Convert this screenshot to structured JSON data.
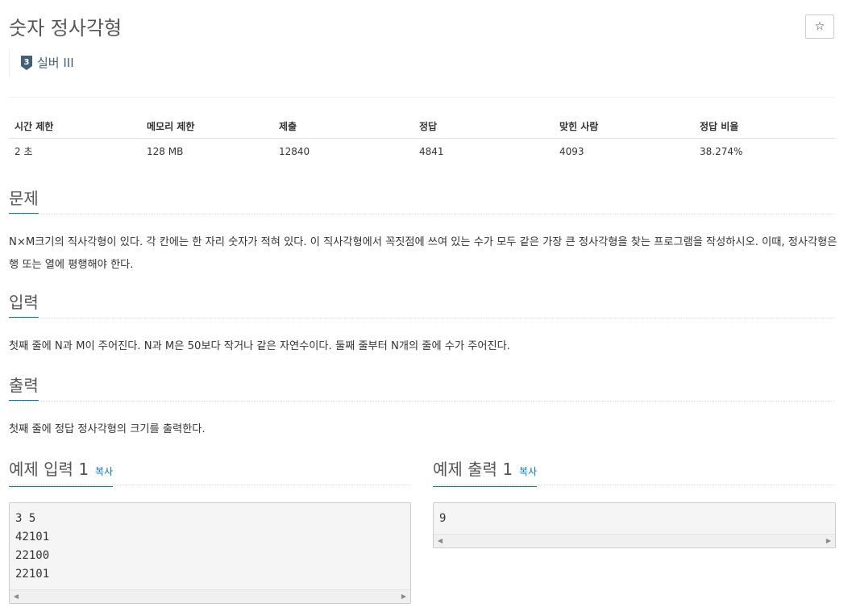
{
  "problem": {
    "title": "숫자 정사각형",
    "star_icon": "☆",
    "tier": {
      "label": "실버 III",
      "icon_number": "3",
      "color": "#435f7a"
    }
  },
  "info_table": {
    "headers": [
      "시간 제한",
      "메모리 제한",
      "제출",
      "정답",
      "맞힌 사람",
      "정답 비율"
    ],
    "values": [
      "2 초",
      "128 MB",
      "12840",
      "4841",
      "4093",
      "38.274%"
    ]
  },
  "sections": {
    "problem": {
      "heading": "문제",
      "body": "N×M크기의 직사각형이 있다. 각 칸에는 한 자리 숫자가 적혀 있다. 이 직사각형에서 꼭짓점에 쓰여 있는 수가 모두 같은 가장 큰 정사각형을 찾는 프로그램을 작성하시오. 이때, 정사각형은 행 또는 열에 평행해야 한다."
    },
    "input": {
      "heading": "입력",
      "body": "첫째 줄에 N과 M이 주어진다. N과 M은 50보다 작거나 같은 자연수이다. 둘째 줄부터 N개의 줄에 수가 주어진다."
    },
    "output": {
      "heading": "출력",
      "body": "첫째 줄에 정답 정사각형의 크기를 출력한다."
    },
    "sample_input": {
      "heading": "예제 입력 1",
      "copy_label": "복사",
      "content": "3 5\n42101\n22100\n22101"
    },
    "sample_output": {
      "heading": "예제 출력 1",
      "copy_label": "복사",
      "content": "9"
    }
  },
  "colors": {
    "accent": "#0076c0",
    "tier": "#435f7a"
  },
  "scroll_arrows": {
    "left": "◀",
    "right": "▶"
  }
}
